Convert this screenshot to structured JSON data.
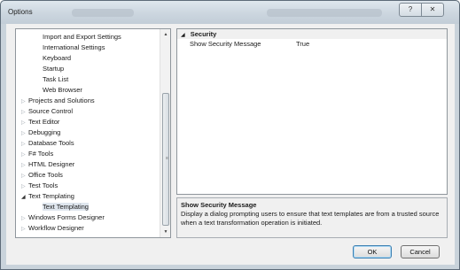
{
  "window": {
    "title": "Options",
    "help_label": "?",
    "close_label": "✕"
  },
  "tree": {
    "items": [
      {
        "label": "Import and Export Settings",
        "indent": 1,
        "arrow": ""
      },
      {
        "label": "International Settings",
        "indent": 1,
        "arrow": ""
      },
      {
        "label": "Keyboard",
        "indent": 1,
        "arrow": ""
      },
      {
        "label": "Startup",
        "indent": 1,
        "arrow": ""
      },
      {
        "label": "Task List",
        "indent": 1,
        "arrow": ""
      },
      {
        "label": "Web Browser",
        "indent": 1,
        "arrow": ""
      },
      {
        "label": "Projects and Solutions",
        "indent": 0,
        "arrow": "▷"
      },
      {
        "label": "Source Control",
        "indent": 0,
        "arrow": "▷"
      },
      {
        "label": "Text Editor",
        "indent": 0,
        "arrow": "▷"
      },
      {
        "label": "Debugging",
        "indent": 0,
        "arrow": "▷"
      },
      {
        "label": "Database Tools",
        "indent": 0,
        "arrow": "▷"
      },
      {
        "label": "F# Tools",
        "indent": 0,
        "arrow": "▷"
      },
      {
        "label": "HTML Designer",
        "indent": 0,
        "arrow": "▷"
      },
      {
        "label": "Office Tools",
        "indent": 0,
        "arrow": "▷"
      },
      {
        "label": "Test Tools",
        "indent": 0,
        "arrow": "▷"
      },
      {
        "label": "Text Templating",
        "indent": 0,
        "arrow": "◢",
        "expanded": true
      },
      {
        "label": "Text Templating",
        "indent": 1,
        "arrow": "",
        "selected": true
      },
      {
        "label": "Windows Forms Designer",
        "indent": 0,
        "arrow": "▷"
      },
      {
        "label": "Workflow Designer",
        "indent": 0,
        "arrow": "▷"
      }
    ]
  },
  "grid": {
    "category": "Security",
    "category_arrow": "◢",
    "rows": [
      {
        "name": "Show Security Message",
        "value": "True"
      }
    ]
  },
  "description": {
    "title": "Show Security Message",
    "text": "Display a dialog prompting users to ensure that text templates are from a trusted source when a text transformation operation is initiated."
  },
  "buttons": {
    "ok": "OK",
    "cancel": "Cancel"
  },
  "colors": {
    "window_frame": "#c9d3db",
    "client_bg": "#f0f0f0",
    "selection": "#dfe6ee"
  }
}
